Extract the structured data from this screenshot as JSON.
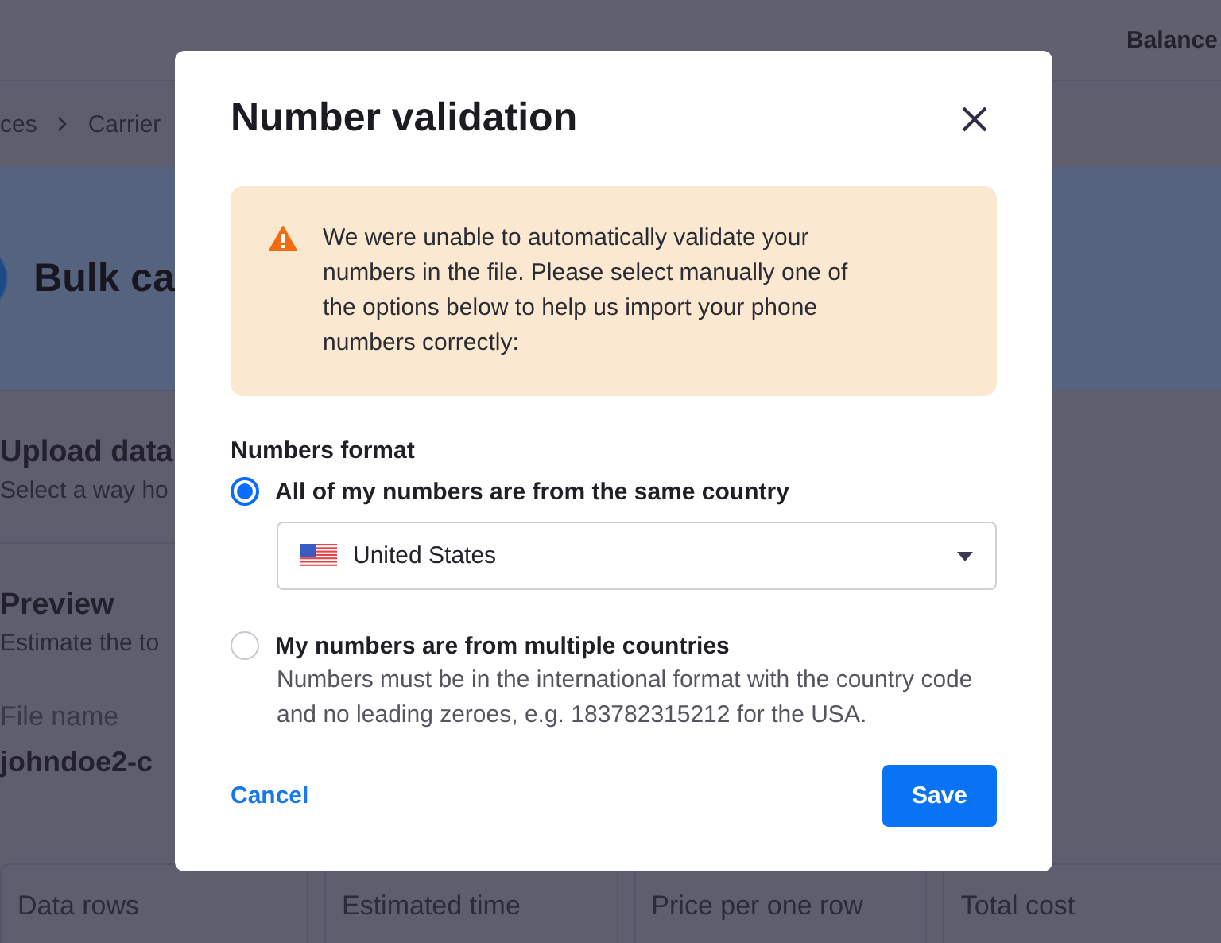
{
  "page": {
    "header": {
      "balance_label": "Balance"
    },
    "breadcrumbs": [
      "ces",
      "Carrier"
    ],
    "banner": {
      "title": "Bulk ca"
    },
    "sections": [
      {
        "title": "Upload data",
        "subtitle": "Select a way ho"
      },
      {
        "title": "Preview",
        "subtitle": "Estimate the to"
      }
    ],
    "file": {
      "label": "File name",
      "value": "johndoe2-c"
    },
    "stats": [
      {
        "label": "Data rows"
      },
      {
        "label": "Estimated time"
      },
      {
        "label": "Price per one row"
      },
      {
        "label": "Total cost"
      }
    ]
  },
  "dialog": {
    "title": "Number validation",
    "alert": {
      "text": "We were unable to automatically validate your numbers in the file. Please select manually one of the options below to help us import your phone numbers correctly:"
    },
    "format_label": "Numbers format",
    "options": [
      {
        "label": "All of my numbers are from the same country",
        "selected": true,
        "country": "United States"
      },
      {
        "label": "My numbers are from multiple countries",
        "selected": false,
        "help": "Numbers must be in the international format with the country code and no leading zeroes, e.g. 183782315212 for the USA."
      }
    ],
    "buttons": [
      {
        "kind": "link",
        "label": "Cancel"
      },
      {
        "kind": "primary",
        "label": "Save"
      }
    ]
  }
}
